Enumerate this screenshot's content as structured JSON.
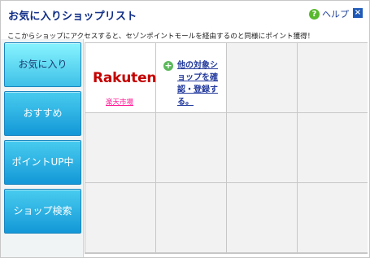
{
  "window": {
    "title": "お気に入りショップリスト",
    "help_label": "ヘルプ",
    "close_label": "×"
  },
  "notice": "ここからショップにアクセスすると、セゾンポイントモールを経由するのと同様にポイント獲得！",
  "sidebar": {
    "items": [
      {
        "label": "お気に入り",
        "active": true
      },
      {
        "label": "おすすめ",
        "active": false
      },
      {
        "label": "ポイントUP中",
        "active": false
      },
      {
        "label": "ショップ検索",
        "active": false
      }
    ]
  },
  "grid": {
    "shop": {
      "logo": "Rakuten",
      "link": "楽天市場"
    },
    "add_text": "他の対象ショップを確認・登録する。"
  },
  "icons": {
    "help": "question-circle-icon",
    "close": "close-icon",
    "add": "plus-circle-icon"
  },
  "colors": {
    "title": "#0f2d86",
    "button_top": "#48ccef",
    "button_bottom": "#1498d7",
    "rakuten": "#c40000",
    "link": "#ff1493"
  }
}
